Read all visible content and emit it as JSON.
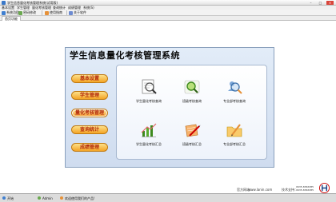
{
  "window": {
    "title": "学生信息量化考核管理系统(试用版)",
    "controls": {
      "minimize": "–",
      "maximize": "□",
      "close": "×"
    }
  },
  "menu": [
    "基本设置",
    "学生管理",
    "量化考核管理",
    "查询统计",
    "成绩管理",
    "系统(S)"
  ],
  "toolbar": [
    {
      "label": "系统功能",
      "icon": "home-icon",
      "color": "#3f7fd0"
    },
    {
      "label": "密码修改",
      "icon": "key-icon",
      "color": "#6aa84f"
    },
    {
      "label": "使用指南",
      "icon": "help-icon",
      "color": "#e69138"
    },
    {
      "label": "关于软件",
      "icon": "info-icon",
      "color": "#6d8bd1"
    }
  ],
  "tab_label": "首页功能",
  "panel": {
    "title": "学生信息量化考核管理系统",
    "nav": [
      "基本设置",
      "学生管理",
      "量化考核管理",
      "查询统计",
      "成绩管理"
    ],
    "functions": [
      {
        "label": "学生量化考核查询",
        "icon": "magnifier-document-icon"
      },
      {
        "label": "班级考核查询",
        "icon": "magnifier-green-icon"
      },
      {
        "label": "专业部考核查询",
        "icon": "search-people-icon"
      },
      {
        "label": "学生量化考核汇总",
        "icon": "chart-summary-icon"
      },
      {
        "label": "班级考核汇总",
        "icon": "pencil-notebook-icon"
      },
      {
        "label": "专业部考核汇总",
        "icon": "folder-pencil-icon"
      }
    ]
  },
  "footer": {
    "website_label": "官方网站：",
    "website": "www.lanin.com",
    "support_label": "技术支持：",
    "phone1": "0635-8366385",
    "phone2": "0635-8366385"
  },
  "taskbar": {
    "start": "开始",
    "user": "Admin",
    "welcome": "欢迎使用我们的产品!"
  }
}
